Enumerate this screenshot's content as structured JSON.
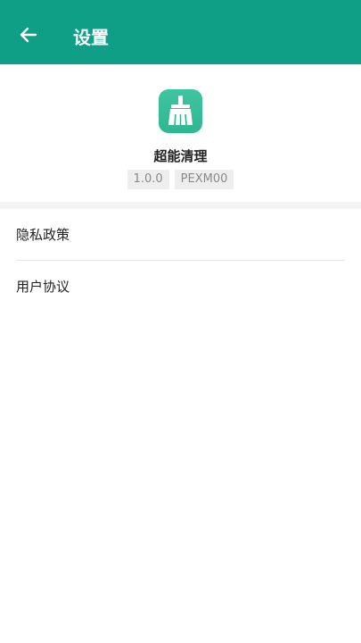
{
  "header": {
    "title": "设置",
    "back_icon": "arrow-left-icon",
    "background_color": "#0f9e86"
  },
  "app_info": {
    "icon": "broom-cleaner-icon",
    "name": "超能清理",
    "version": "1.0.0",
    "model": "PEXM00"
  },
  "menu": {
    "items": [
      {
        "label": "隐私政策"
      },
      {
        "label": "用户协议"
      }
    ]
  }
}
